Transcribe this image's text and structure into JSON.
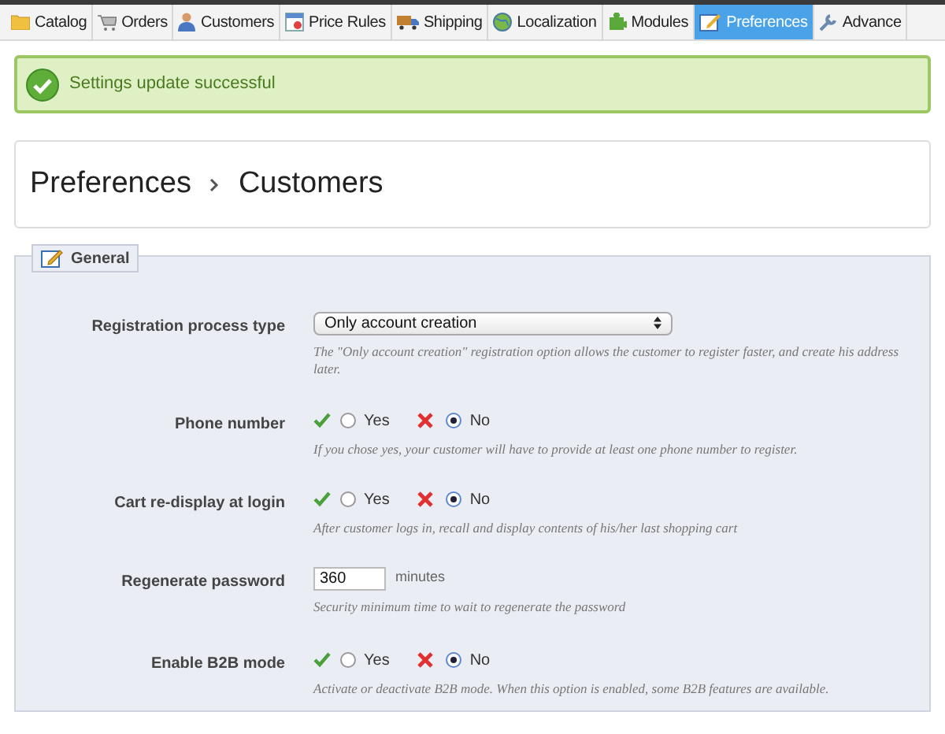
{
  "tabs": [
    {
      "label": "Catalog",
      "selected": false
    },
    {
      "label": "Orders",
      "selected": false
    },
    {
      "label": "Customers",
      "selected": false
    },
    {
      "label": "Price Rules",
      "selected": false
    },
    {
      "label": "Shipping",
      "selected": false
    },
    {
      "label": "Localization",
      "selected": false
    },
    {
      "label": "Modules",
      "selected": false
    },
    {
      "label": "Preferences",
      "selected": true
    },
    {
      "label": "Advance",
      "selected": false
    }
  ],
  "message": {
    "text": "Settings update successful"
  },
  "breadcrumb": [
    "Preferences",
    "Customers"
  ],
  "fieldset": {
    "legend": "General",
    "fields": [
      {
        "kind": "select",
        "label": "Registration process type",
        "value": "Only account creation",
        "help": "The \"Only account creation\" registration option allows the customer to register faster, and create his address later."
      },
      {
        "kind": "radio",
        "label": "Phone number",
        "options": [
          {
            "label": "Yes",
            "selected": false
          },
          {
            "label": "No",
            "selected": true
          }
        ],
        "help": "If you chose yes, your customer will have to provide at least one phone number to register."
      },
      {
        "kind": "radio",
        "label": "Cart re-display at login",
        "options": [
          {
            "label": "Yes",
            "selected": false
          },
          {
            "label": "No",
            "selected": true
          }
        ],
        "help": "After customer logs in, recall and display contents of his/her last shopping cart"
      },
      {
        "kind": "number",
        "label": "Regenerate password",
        "value": "360",
        "unit": "minutes",
        "help": "Security minimum time to wait to regenerate the password"
      },
      {
        "kind": "radio",
        "label": "Enable B2B mode",
        "options": [
          {
            "label": "Yes",
            "selected": false
          },
          {
            "label": "No",
            "selected": true
          }
        ],
        "help": "Activate or deactivate B2B mode. When this option is enabled, some B2B features are available."
      }
    ]
  }
}
